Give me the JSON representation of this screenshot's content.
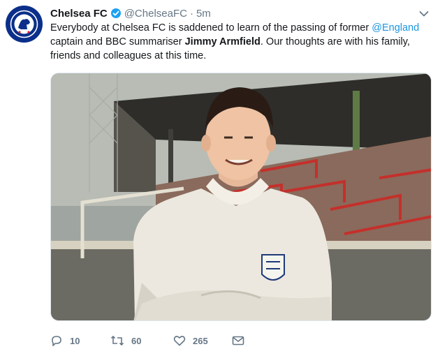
{
  "tweet": {
    "author_name": "Chelsea FC",
    "handle": "@ChelseaFC",
    "separator": "·",
    "time_ago": "5m",
    "text_part1": "Everybody at Chelsea FC is saddened to learn of the passing of former ",
    "mention": "@England",
    "text_part2": " captain and BBC summariser ",
    "bold_name": "Jimmy Armfield",
    "text_part3": ". Our thoughts are with his family, friends and colleagues at this  time.",
    "avatar_icon": "chelsea-crest-icon",
    "brand_color": "#0b2f8a",
    "link_color": "#1b95e0"
  },
  "actions": {
    "reply_count": "10",
    "retweet_count": "60",
    "like_count": "265",
    "reply_icon": "reply-icon",
    "retweet_icon": "retweet-icon",
    "like_icon": "heart-icon",
    "dm_icon": "envelope-icon"
  }
}
